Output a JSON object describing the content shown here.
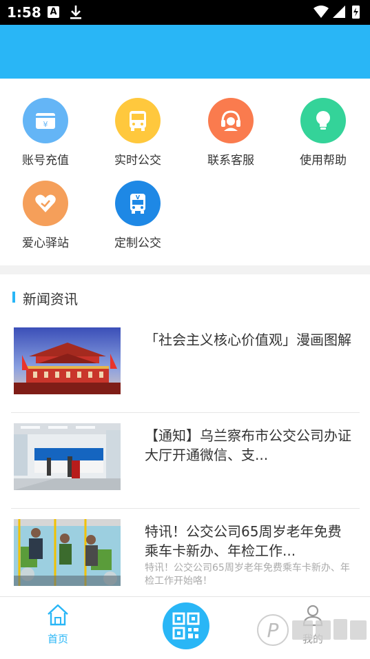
{
  "status_bar": {
    "time": "1:58",
    "a_icon": "A"
  },
  "grid": {
    "items": [
      {
        "label": "账号充值",
        "icon": "wallet-icon",
        "color": "#64b5f6"
      },
      {
        "label": "实时公交",
        "icon": "bus-icon",
        "color": "#ffc83d"
      },
      {
        "label": "联系客服",
        "icon": "customer-service-icon",
        "color": "#fa7b4e"
      },
      {
        "label": "使用帮助",
        "icon": "lightbulb-icon",
        "color": "#34d399"
      },
      {
        "label": "爱心驿站",
        "icon": "heart-icon",
        "color": "#f59f5a"
      },
      {
        "label": "定制公交",
        "icon": "custom-bus-icon",
        "color": "#1e88e5"
      }
    ]
  },
  "news": {
    "section_title": "新闻资讯",
    "items": [
      {
        "headline": "「社会主义核心价值观」漫画图解",
        "summary": ""
      },
      {
        "headline": "【通知】乌兰察布市公交公司办证大厅开通微信、支...",
        "summary": ""
      },
      {
        "headline": "特讯！公交公司65周岁老年免费乘车卡新办、年检工作...",
        "summary": "特讯！公交公司65周岁老年免费乘车卡新办、年检工作开始咯！"
      }
    ]
  },
  "tabbar": {
    "home_label": "首页",
    "mine_label": "我的"
  },
  "colors": {
    "accent": "#29b6f6"
  }
}
